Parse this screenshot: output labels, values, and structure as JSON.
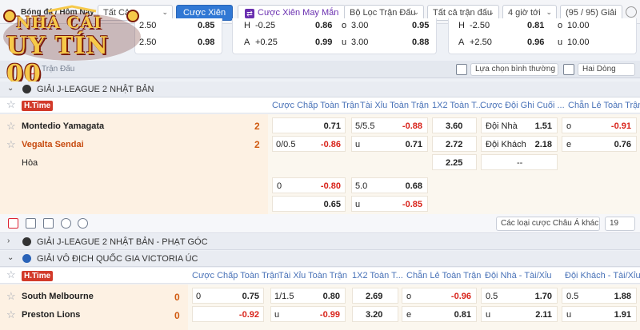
{
  "toolbar": {
    "title": "Bóng đá / Hôm Nay",
    "filter_all": "Tất Cả",
    "btn_parlay": "Cược Xiên",
    "btn_lucky_parlay": "Cược Xiên May Mắn",
    "btn_lucky_icon": "shuffle-icon",
    "match_filter": "Bộ Lọc Trận Đấu",
    "all_matches": "Tất cả trận đấu",
    "hours": "4 giờ tới",
    "league_count": "(95 / 95) Giải"
  },
  "top_odds": {
    "card1": [
      {
        "line": "2.50",
        "value": "0.85"
      },
      {
        "line": "2.50",
        "value": "0.98"
      }
    ],
    "card2": [
      {
        "side": "H",
        "line": "-0.25",
        "value": "0.86",
        "ou": "o",
        "ou_line": "3.00",
        "ou_value": "0.95"
      },
      {
        "side": "A",
        "line": "+0.25",
        "value": "0.99",
        "ou": "u",
        "ou_line": "3.00",
        "ou_value": "0.88"
      }
    ],
    "card3": [
      {
        "side": "H",
        "line": "-2.50",
        "value": "0.81",
        "ou": "o",
        "ou_line": "10.00"
      },
      {
        "side": "A",
        "line": "+2.50",
        "value": "0.96",
        "ou": "u",
        "ou_line": "10.00"
      }
    ]
  },
  "logo": {
    "line1": "NHÀ CÁI",
    "line2": "UY TÍN 00"
  },
  "section": {
    "label": "Trận Đấu",
    "view_select": "Lựa chọn bình thường",
    "column_select": "Hai Dòng"
  },
  "league1": {
    "name": "GIẢI J-LEAGUE 2 NHẬT BẢN",
    "htime": "H.Time",
    "headers": [
      "Cược Chấp Toàn Trận",
      "Tài Xỉu Toàn Trận",
      "1X2 Toàn T...",
      "Cược Đội Ghi Cuối ...",
      "Chẵn Lẻ Toàn Trận"
    ],
    "home": {
      "name": "Montedio Yamagata",
      "score": "2"
    },
    "away": {
      "name": "Vegalta Sendai",
      "score": "2"
    },
    "draw": "Hòa",
    "rows": {
      "home_hdp": "0.71",
      "home_ou_line": "5/5.5",
      "home_ou": "-0.88",
      "home_1x2": "3.60",
      "home_last_label": "Đội Nhà",
      "home_last": "1.51",
      "home_oe_label": "o",
      "home_oe": "-0.91",
      "away_hdp_line": "0/0.5",
      "away_hdp": "-0.86",
      "away_ou_label": "u",
      "away_ou": "0.71",
      "away_1x2": "2.72",
      "away_last_label": "Đội Khách",
      "away_last": "2.18",
      "away_oe_label": "e",
      "away_oe": "0.76",
      "draw_1x2": "2.25",
      "draw_last": "--"
    },
    "alt": {
      "hdp_line": "0",
      "hdp1": "-0.80",
      "hdp2": "0.65",
      "ou_line": "5.0",
      "ou1": "0.68",
      "ou_label2": "u",
      "ou2": "-0.85"
    }
  },
  "footbar": {
    "other_bets": "Các loại cược Châu Á khác",
    "count": "19"
  },
  "league2": {
    "name": "GIẢI J-LEAGUE 2 NHẬT BẢN - PHẠT GÓC"
  },
  "league3": {
    "name": "GIẢI VÔ ĐỊCH QUỐC GIA VICTORIA ÚC",
    "htime": "H.Time",
    "headers": [
      "Cược Chấp Toàn Trận",
      "Tài Xỉu Toàn Trận",
      "1X2 Toàn T...",
      "Chẵn Lẻ Toàn Trận",
      "Đội Nhà - Tài/Xỉu",
      "Đội Khách - Tài/Xỉu"
    ],
    "home": {
      "name": "South Melbourne",
      "score": "0"
    },
    "away": {
      "name": "Preston Lions",
      "score": "0"
    },
    "rows": {
      "home_hdp_line": "0",
      "home_hdp": "0.75",
      "home_ou_line": "1/1.5",
      "home_ou": "0.80",
      "home_1x2": "2.69",
      "home_oe_label": "o",
      "home_oe": "-0.96",
      "home_team_ou_line": "0.5",
      "home_team_ou": "1.70",
      "away_team_ou_line": "0.5",
      "away_team_ou": "1.88",
      "away_hdp": "-0.92",
      "away_ou_label": "u",
      "away_ou": "-0.99",
      "away_1x2": "3.20",
      "away_oe_label": "e",
      "away_oe": "0.81",
      "away_home_ou_label": "u",
      "away_home_ou": "2.11",
      "away_away_ou_label": "u",
      "away_away_ou": "1.91"
    }
  },
  "colors": {
    "accent_blue": "#3178d4",
    "negative": "#d8231a",
    "orange": "#c74b10",
    "htime_red": "#d23a2a",
    "match_bg": "#fdf1e3"
  }
}
